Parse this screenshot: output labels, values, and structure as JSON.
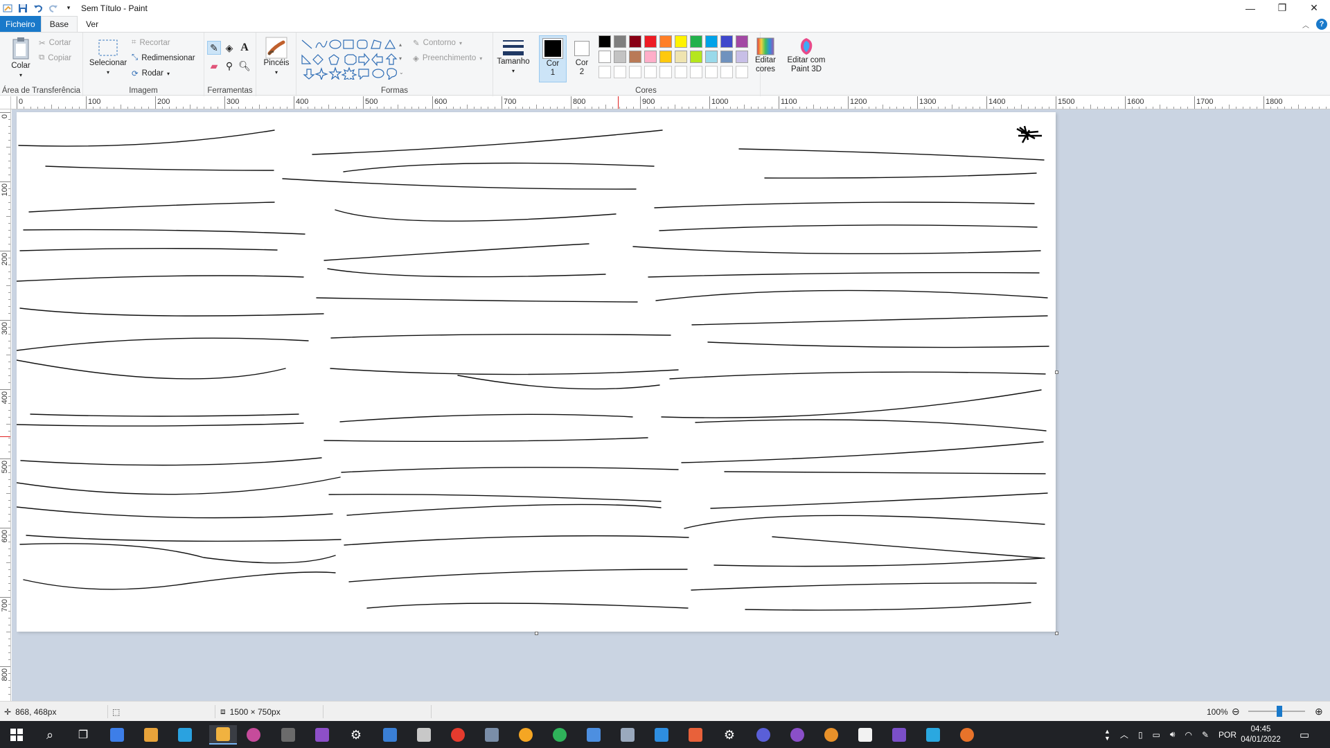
{
  "window": {
    "title": "Sem Título - Paint",
    "minimize": "—",
    "restore": "❐",
    "close": "✕"
  },
  "tabs": {
    "file": "Ficheiro",
    "home": "Base",
    "view": "Ver"
  },
  "ribbon": {
    "clipboard": {
      "label": "Área de Transferência",
      "paste": "Colar",
      "cut": "Cortar",
      "copy": "Copiar"
    },
    "image": {
      "label": "Imagem",
      "select": "Selecionar",
      "crop": "Recortar",
      "resize": "Redimensionar",
      "rotate": "Rodar"
    },
    "tools": {
      "label": "Ferramentas"
    },
    "brushes": {
      "label": "Pincéis"
    },
    "shapes": {
      "label": "Formas",
      "outline": "Contorno",
      "fill": "Preenchimento"
    },
    "size": {
      "label": "Tamanho"
    },
    "colors": {
      "label": "Cores",
      "color1": "Cor 1",
      "color2": "Cor 2",
      "edit_colors": "Editar cores",
      "palette_row1": [
        "#000000",
        "#7f7f7f",
        "#880015",
        "#ed1c24",
        "#ff7f27",
        "#fff200",
        "#22b14c",
        "#00a2e8",
        "#3f48cc",
        "#a349a4"
      ],
      "palette_row2": [
        "#ffffff",
        "#c3c3c3",
        "#b97a57",
        "#ffaec9",
        "#ffc90e",
        "#efe4b0",
        "#b5e61d",
        "#99d9ea",
        "#7092be",
        "#c8bfe7"
      ]
    },
    "paint3d": {
      "label": "Editar com Paint 3D"
    }
  },
  "ruler": {
    "h_marks": [
      "0",
      "100",
      "200",
      "300",
      "400",
      "500",
      "600",
      "700",
      "800",
      "900",
      "1000",
      "1100",
      "1200",
      "1300",
      "1400",
      "1500",
      "1600",
      "1700",
      "1800"
    ],
    "v_marks": [
      "0",
      "100",
      "200",
      "300",
      "400",
      "500",
      "600",
      "700",
      "800"
    ]
  },
  "status": {
    "cursor_pos": "868, 468px",
    "canvas_size": "1500 × 750px",
    "zoom": "100%"
  },
  "taskbar": {
    "language": "POR",
    "time": "04:45",
    "date": "04/01/2022"
  }
}
